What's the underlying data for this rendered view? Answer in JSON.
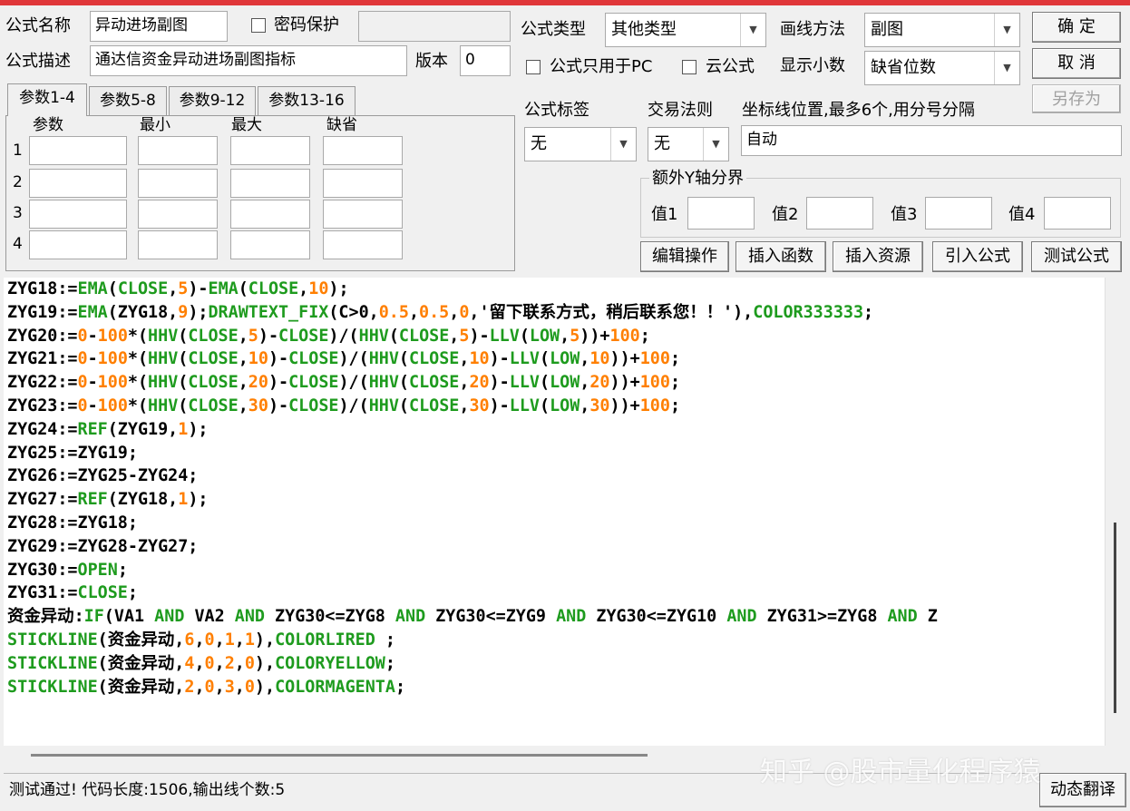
{
  "form": {
    "name_label": "公式名称",
    "name_value": "异动进场副图",
    "password_label": "密码保护",
    "desc_label": "公式描述",
    "desc_value": "通达信资金异动进场副图指标",
    "version_label": "版本",
    "version_value": "0",
    "type_label": "公式类型",
    "type_value": "其他类型",
    "draw_label": "画线方法",
    "draw_value": "副图",
    "pc_only_label": "公式只用于PC",
    "cloud_label": "云公式",
    "decimals_label": "显示小数",
    "decimals_value": "缺省位数",
    "tag_label": "公式标签",
    "tag_value": "无",
    "rule_label": "交易法则",
    "rule_value": "无",
    "axis_label": "坐标线位置,最多6个,用分号分隔",
    "axis_value": "自动",
    "extra_y_label": "额外Y轴分界",
    "val1": "值1",
    "val2": "值2",
    "val3": "值3",
    "val4": "值4"
  },
  "buttons": {
    "ok": "确 定",
    "cancel": "取 消",
    "save_as": "另存为",
    "edit_ops": "编辑操作",
    "insert_func": "插入函数",
    "insert_res": "插入资源",
    "import_formula": "引入公式",
    "test_formula": "测试公式",
    "dynamic_translate": "动态翻译"
  },
  "tabs": [
    "参数1-4",
    "参数5-8",
    "参数9-12",
    "参数13-16"
  ],
  "params": {
    "headers": [
      "参数",
      "最小",
      "最大",
      "缺省"
    ],
    "rows": [
      "1",
      "2",
      "3",
      "4"
    ]
  },
  "code_lines": [
    [
      [
        "k",
        "ZYG18:="
      ],
      [
        "g",
        "EMA"
      ],
      [
        "k",
        "("
      ],
      [
        "g",
        "CLOSE"
      ],
      [
        "k",
        ","
      ],
      [
        "o",
        "5"
      ],
      [
        "k",
        ")-"
      ],
      [
        "g",
        "EMA"
      ],
      [
        "k",
        "("
      ],
      [
        "g",
        "CLOSE"
      ],
      [
        "k",
        ","
      ],
      [
        "o",
        "10"
      ],
      [
        "k",
        ");"
      ]
    ],
    [
      [
        "k",
        "ZYG19:="
      ],
      [
        "g",
        "EMA"
      ],
      [
        "k",
        "(ZYG18,"
      ],
      [
        "o",
        "9"
      ],
      [
        "k",
        ");"
      ],
      [
        "g",
        "DRAWTEXT_FIX"
      ],
      [
        "k",
        "(C>0,"
      ],
      [
        "o",
        "0.5"
      ],
      [
        "k",
        ","
      ],
      [
        "o",
        "0.5"
      ],
      [
        "k",
        ","
      ],
      [
        "o",
        "0"
      ],
      [
        "k",
        ",'留下联系方式，稍后联系您！！'),"
      ],
      [
        "g",
        "COLOR333333"
      ],
      [
        "k",
        ";"
      ]
    ],
    [
      [
        "k",
        "ZYG20:="
      ],
      [
        "o",
        "0"
      ],
      [
        "k",
        "-"
      ],
      [
        "o",
        "100"
      ],
      [
        "k",
        "*("
      ],
      [
        "g",
        "HHV"
      ],
      [
        "k",
        "("
      ],
      [
        "g",
        "CLOSE"
      ],
      [
        "k",
        ","
      ],
      [
        "o",
        "5"
      ],
      [
        "k",
        ")-"
      ],
      [
        "g",
        "CLOSE"
      ],
      [
        "k",
        ")/("
      ],
      [
        "g",
        "HHV"
      ],
      [
        "k",
        "("
      ],
      [
        "g",
        "CLOSE"
      ],
      [
        "k",
        ","
      ],
      [
        "o",
        "5"
      ],
      [
        "k",
        ")-"
      ],
      [
        "g",
        "LLV"
      ],
      [
        "k",
        "("
      ],
      [
        "g",
        "LOW"
      ],
      [
        "k",
        ","
      ],
      [
        "o",
        "5"
      ],
      [
        "k",
        "))+"
      ],
      [
        "o",
        "100"
      ],
      [
        "k",
        ";"
      ]
    ],
    [
      [
        "k",
        "ZYG21:="
      ],
      [
        "o",
        "0"
      ],
      [
        "k",
        "-"
      ],
      [
        "o",
        "100"
      ],
      [
        "k",
        "*("
      ],
      [
        "g",
        "HHV"
      ],
      [
        "k",
        "("
      ],
      [
        "g",
        "CLOSE"
      ],
      [
        "k",
        ","
      ],
      [
        "o",
        "10"
      ],
      [
        "k",
        ")-"
      ],
      [
        "g",
        "CLOSE"
      ],
      [
        "k",
        ")/("
      ],
      [
        "g",
        "HHV"
      ],
      [
        "k",
        "("
      ],
      [
        "g",
        "CLOSE"
      ],
      [
        "k",
        ","
      ],
      [
        "o",
        "10"
      ],
      [
        "k",
        ")-"
      ],
      [
        "g",
        "LLV"
      ],
      [
        "k",
        "("
      ],
      [
        "g",
        "LOW"
      ],
      [
        "k",
        ","
      ],
      [
        "o",
        "10"
      ],
      [
        "k",
        "))+"
      ],
      [
        "o",
        "100"
      ],
      [
        "k",
        ";"
      ]
    ],
    [
      [
        "k",
        "ZYG22:="
      ],
      [
        "o",
        "0"
      ],
      [
        "k",
        "-"
      ],
      [
        "o",
        "100"
      ],
      [
        "k",
        "*("
      ],
      [
        "g",
        "HHV"
      ],
      [
        "k",
        "("
      ],
      [
        "g",
        "CLOSE"
      ],
      [
        "k",
        ","
      ],
      [
        "o",
        "20"
      ],
      [
        "k",
        ")-"
      ],
      [
        "g",
        "CLOSE"
      ],
      [
        "k",
        ")/("
      ],
      [
        "g",
        "HHV"
      ],
      [
        "k",
        "("
      ],
      [
        "g",
        "CLOSE"
      ],
      [
        "k",
        ","
      ],
      [
        "o",
        "20"
      ],
      [
        "k",
        ")-"
      ],
      [
        "g",
        "LLV"
      ],
      [
        "k",
        "("
      ],
      [
        "g",
        "LOW"
      ],
      [
        "k",
        ","
      ],
      [
        "o",
        "20"
      ],
      [
        "k",
        "))+"
      ],
      [
        "o",
        "100"
      ],
      [
        "k",
        ";"
      ]
    ],
    [
      [
        "k",
        "ZYG23:="
      ],
      [
        "o",
        "0"
      ],
      [
        "k",
        "-"
      ],
      [
        "o",
        "100"
      ],
      [
        "k",
        "*("
      ],
      [
        "g",
        "HHV"
      ],
      [
        "k",
        "("
      ],
      [
        "g",
        "CLOSE"
      ],
      [
        "k",
        ","
      ],
      [
        "o",
        "30"
      ],
      [
        "k",
        ")-"
      ],
      [
        "g",
        "CLOSE"
      ],
      [
        "k",
        ")/("
      ],
      [
        "g",
        "HHV"
      ],
      [
        "k",
        "("
      ],
      [
        "g",
        "CLOSE"
      ],
      [
        "k",
        ","
      ],
      [
        "o",
        "30"
      ],
      [
        "k",
        ")-"
      ],
      [
        "g",
        "LLV"
      ],
      [
        "k",
        "("
      ],
      [
        "g",
        "LOW"
      ],
      [
        "k",
        ","
      ],
      [
        "o",
        "30"
      ],
      [
        "k",
        "))+"
      ],
      [
        "o",
        "100"
      ],
      [
        "k",
        ";"
      ]
    ],
    [
      [
        "k",
        "ZYG24:="
      ],
      [
        "g",
        "REF"
      ],
      [
        "k",
        "(ZYG19,"
      ],
      [
        "o",
        "1"
      ],
      [
        "k",
        ");"
      ]
    ],
    [
      [
        "k",
        "ZYG25:=ZYG19;"
      ]
    ],
    [
      [
        "k",
        "ZYG26:=ZYG25-ZYG24;"
      ]
    ],
    [
      [
        "k",
        "ZYG27:="
      ],
      [
        "g",
        "REF"
      ],
      [
        "k",
        "(ZYG18,"
      ],
      [
        "o",
        "1"
      ],
      [
        "k",
        ");"
      ]
    ],
    [
      [
        "k",
        "ZYG28:=ZYG18;"
      ]
    ],
    [
      [
        "k",
        "ZYG29:=ZYG28-ZYG27;"
      ]
    ],
    [
      [
        "k",
        "ZYG30:="
      ],
      [
        "g",
        "OPEN"
      ],
      [
        "k",
        ";"
      ]
    ],
    [
      [
        "k",
        "ZYG31:="
      ],
      [
        "g",
        "CLOSE"
      ],
      [
        "k",
        ";"
      ]
    ],
    [
      [
        "k",
        "资金异动:"
      ],
      [
        "g",
        "IF"
      ],
      [
        "k",
        "(VA1 "
      ],
      [
        "g",
        "AND"
      ],
      [
        "k",
        " VA2 "
      ],
      [
        "g",
        "AND"
      ],
      [
        "k",
        " ZYG30<=ZYG8 "
      ],
      [
        "g",
        "AND"
      ],
      [
        "k",
        " ZYG30<=ZYG9 "
      ],
      [
        "g",
        "AND"
      ],
      [
        "k",
        " ZYG30<=ZYG10 "
      ],
      [
        "g",
        "AND"
      ],
      [
        "k",
        " ZYG31>=ZYG8 "
      ],
      [
        "g",
        "AND"
      ],
      [
        "k",
        " Z"
      ]
    ],
    [
      [
        "g",
        "STICKLINE"
      ],
      [
        "k",
        "(资金异动,"
      ],
      [
        "o",
        "6"
      ],
      [
        "k",
        ","
      ],
      [
        "o",
        "0"
      ],
      [
        "k",
        ","
      ],
      [
        "o",
        "1"
      ],
      [
        "k",
        ","
      ],
      [
        "o",
        "1"
      ],
      [
        "k",
        "),"
      ],
      [
        "g",
        "COLORLIRED"
      ],
      [
        "k",
        " ;"
      ]
    ],
    [
      [
        "g",
        "STICKLINE"
      ],
      [
        "k",
        "(资金异动,"
      ],
      [
        "o",
        "4"
      ],
      [
        "k",
        ","
      ],
      [
        "o",
        "0"
      ],
      [
        "k",
        ","
      ],
      [
        "o",
        "2"
      ],
      [
        "k",
        ","
      ],
      [
        "o",
        "0"
      ],
      [
        "k",
        "),"
      ],
      [
        "g",
        "COLORYELLOW"
      ],
      [
        "k",
        ";"
      ]
    ],
    [
      [
        "g",
        "STICKLINE"
      ],
      [
        "k",
        "(资金异动,"
      ],
      [
        "o",
        "2"
      ],
      [
        "k",
        ","
      ],
      [
        "o",
        "0"
      ],
      [
        "k",
        ","
      ],
      [
        "o",
        "3"
      ],
      [
        "k",
        ","
      ],
      [
        "o",
        "0"
      ],
      [
        "k",
        "),"
      ],
      [
        "g",
        "COLORMAGENTA"
      ],
      [
        "k",
        ";"
      ]
    ]
  ],
  "status": "测试通过! 代码长度:1506,输出线个数:5",
  "watermark": "知乎 @股市量化程序猿",
  "colors": {
    "keyword": "#1e9b1e",
    "number": "#ff7f00",
    "title_bar": "#e0373a"
  }
}
